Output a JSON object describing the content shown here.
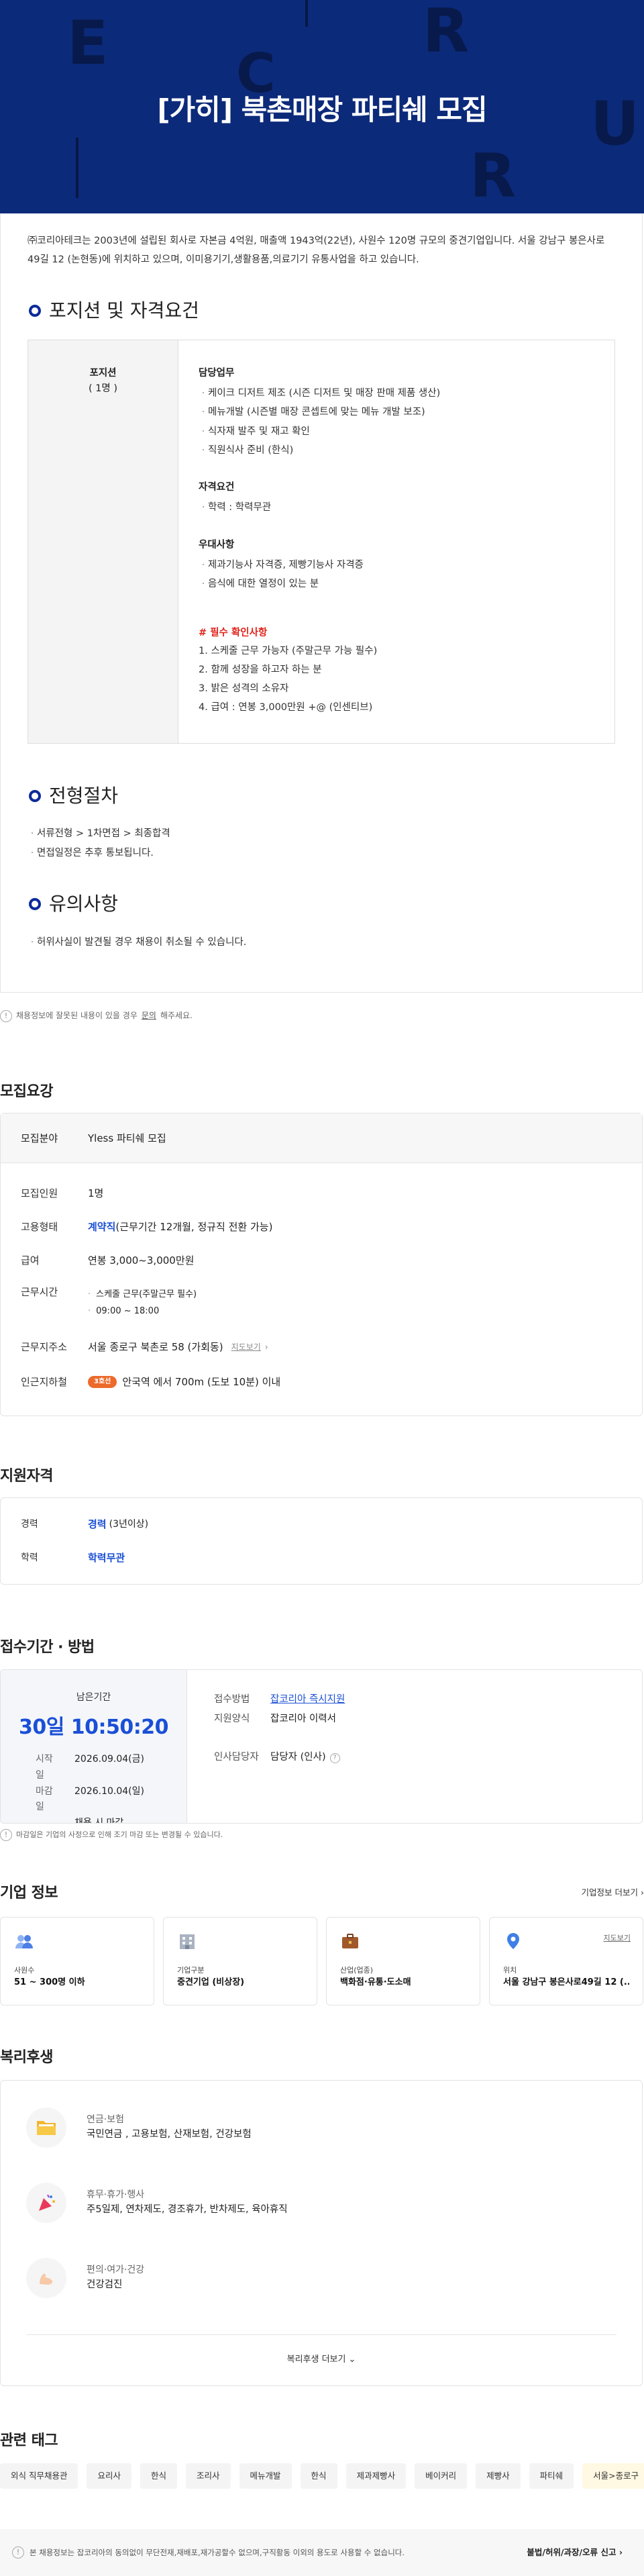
{
  "hero": {
    "title": "[가히] 북촌매장 파티쉐 모집"
  },
  "intro": "㈜코리아테크는 2003년에 설립된 회사로 자본금 4억원, 매출액 1943억(22년), 사원수 120명 규모의 중견기업입니다. 서울 강남구 봉은사로49길 12 (논현동)에 위치하고 있으며, 이미용기기,생활용품,의료기기 유통사업을 하고 있습니다.",
  "position": {
    "title": "포지션 및 자격요건",
    "name": "포지션",
    "count": "( 1명 )",
    "duties_title": "담당업무",
    "duties": [
      "케이크 디저트 제조 (시즌 디저트 및 매장 판매 제품 생산)",
      "메뉴개발 (시즌별 매장 콘셉트에 맞는 메뉴 개발 보조)",
      "식자재 발주 및 재고 확인",
      "직원식사 준비 (한식)"
    ],
    "req_title": "자격요건",
    "reqs": [
      "학력 : 학력무관"
    ],
    "pref_title": "우대사항",
    "prefs": [
      "제과기능사 자격증, 제빵기능사 자격증",
      "음식에 대한 열정이 있는 분"
    ],
    "must_title": "# 필수 확인사항",
    "musts": [
      "1. 스케줄 근무 가능자 (주말근무 가능 필수)",
      "2. 함께 성장을 하고자 하는 분",
      "3. 밝은 성격의 소유자",
      "4. 급여 : 연봉 3,000만원 +@ (인센티브)"
    ]
  },
  "process": {
    "title": "전형절차",
    "items": [
      "서류전형 > 1차면접 > 최종합격",
      "면접일정은 추후 통보됩니다."
    ]
  },
  "caution": {
    "title": "유의사항",
    "items": [
      "허위사실이 발견될 경우 채용이 취소될 수 있습니다."
    ]
  },
  "report_notice": {
    "pre": "채용정보에 잘못된 내용이 있을 경우 ",
    "link": "문의",
    "post": "해주세요."
  },
  "recruit": {
    "title": "모집요강",
    "field_label": "모집분야",
    "field_value": "Yless 파티쉐 모집",
    "count_label": "모집인원",
    "count_value": "1명",
    "type_label": "고용형태",
    "type_value": "계약직",
    "type_extra": "(근무기간 12개월, 정규직 전환 가능)",
    "salary_label": "급여",
    "salary_value": "연봉 3,000~3,000만원",
    "time_label": "근무시간",
    "time_items": [
      "스케줄 근무(주말근무 필수)",
      "09:00 ~ 18:00"
    ],
    "addr_label": "근무지주소",
    "addr_value": "서울 종로구 북촌로 58 (가회동)",
    "map_link": "지도보기",
    "station_label": "인근지하철",
    "station_line": "3호선",
    "station_value": "안국역 에서 700m (도보 10분) 이내"
  },
  "qualify": {
    "title": "지원자격",
    "career_label": "경력",
    "career_value": "경력",
    "career_extra": "(3년이상)",
    "edu_label": "학력",
    "edu_value": "학력무관"
  },
  "period": {
    "title": "접수기간 · 방법",
    "remain_label": "남은기간",
    "remain_value": "30일 10:50:20",
    "start_label": "시작일",
    "start_value": "2026.09.04(금)",
    "end_label": "마감일",
    "end_value": "2026.10.04(일)",
    "end_extra": "채용 시 마감",
    "method_label": "접수방법",
    "method_value": "잡코리아 즉시지원",
    "form_label": "지원양식",
    "form_value": "잡코리아 이력서",
    "hr_label": "인사담당자",
    "hr_value": "담당자 (인사)",
    "notice": "마감일은 기업의 사정으로 인해 조기 마감 또는 변경될 수 있습니다."
  },
  "company": {
    "title": "기업 정보",
    "more": "기업정보 더보기",
    "cards": [
      {
        "label": "사원수",
        "value": "51 ~ 300명 이하",
        "icon": "people-icon"
      },
      {
        "label": "기업구분",
        "value": "중견기업 (비상장)",
        "icon": "building-icon"
      },
      {
        "label": "산업(업종)",
        "value": "백화점·유통·도소매",
        "icon": "briefcase-icon"
      },
      {
        "label": "위치",
        "value": "서울 강남구 봉은사로49길 12 (...",
        "icon": "location-icon",
        "map": "지도보기"
      }
    ]
  },
  "welfare": {
    "title": "복리후생",
    "items": [
      {
        "label": "연금·보험",
        "value": "국민연금 , 고용보험, 산재보험, 건강보험",
        "icon": "folder-icon"
      },
      {
        "label": "휴무·휴가·행사",
        "value": "주5일제, 연차제도, 경조휴가, 반차제도, 육아휴직",
        "icon": "party-icon"
      },
      {
        "label": "편의·여가·건강",
        "value": "건강검진",
        "icon": "muscle-icon"
      }
    ],
    "more": "복리후생 더보기"
  },
  "tags": {
    "title": "관련 태그",
    "items": [
      "외식 직무채용관",
      "요리사",
      "한식",
      "조리사",
      "메뉴개발",
      "한식",
      "제과제빵사",
      "베이커리",
      "제빵사",
      "파티쉐",
      "서울>종로구"
    ]
  },
  "footer": {
    "notice": "본 채용정보는 잡코리아의 동의없이 무단전재,재배포,재가공할수 없으며,구직활동 이외의 용도로 사용할 수 없습니다.",
    "report": "불법/허위/과장/오류 신고"
  },
  "colors": {
    "hero": "#0c2a7a",
    "accent": "#1a4fd6",
    "red": "#e2231a",
    "subway": "#ec6a2b"
  }
}
